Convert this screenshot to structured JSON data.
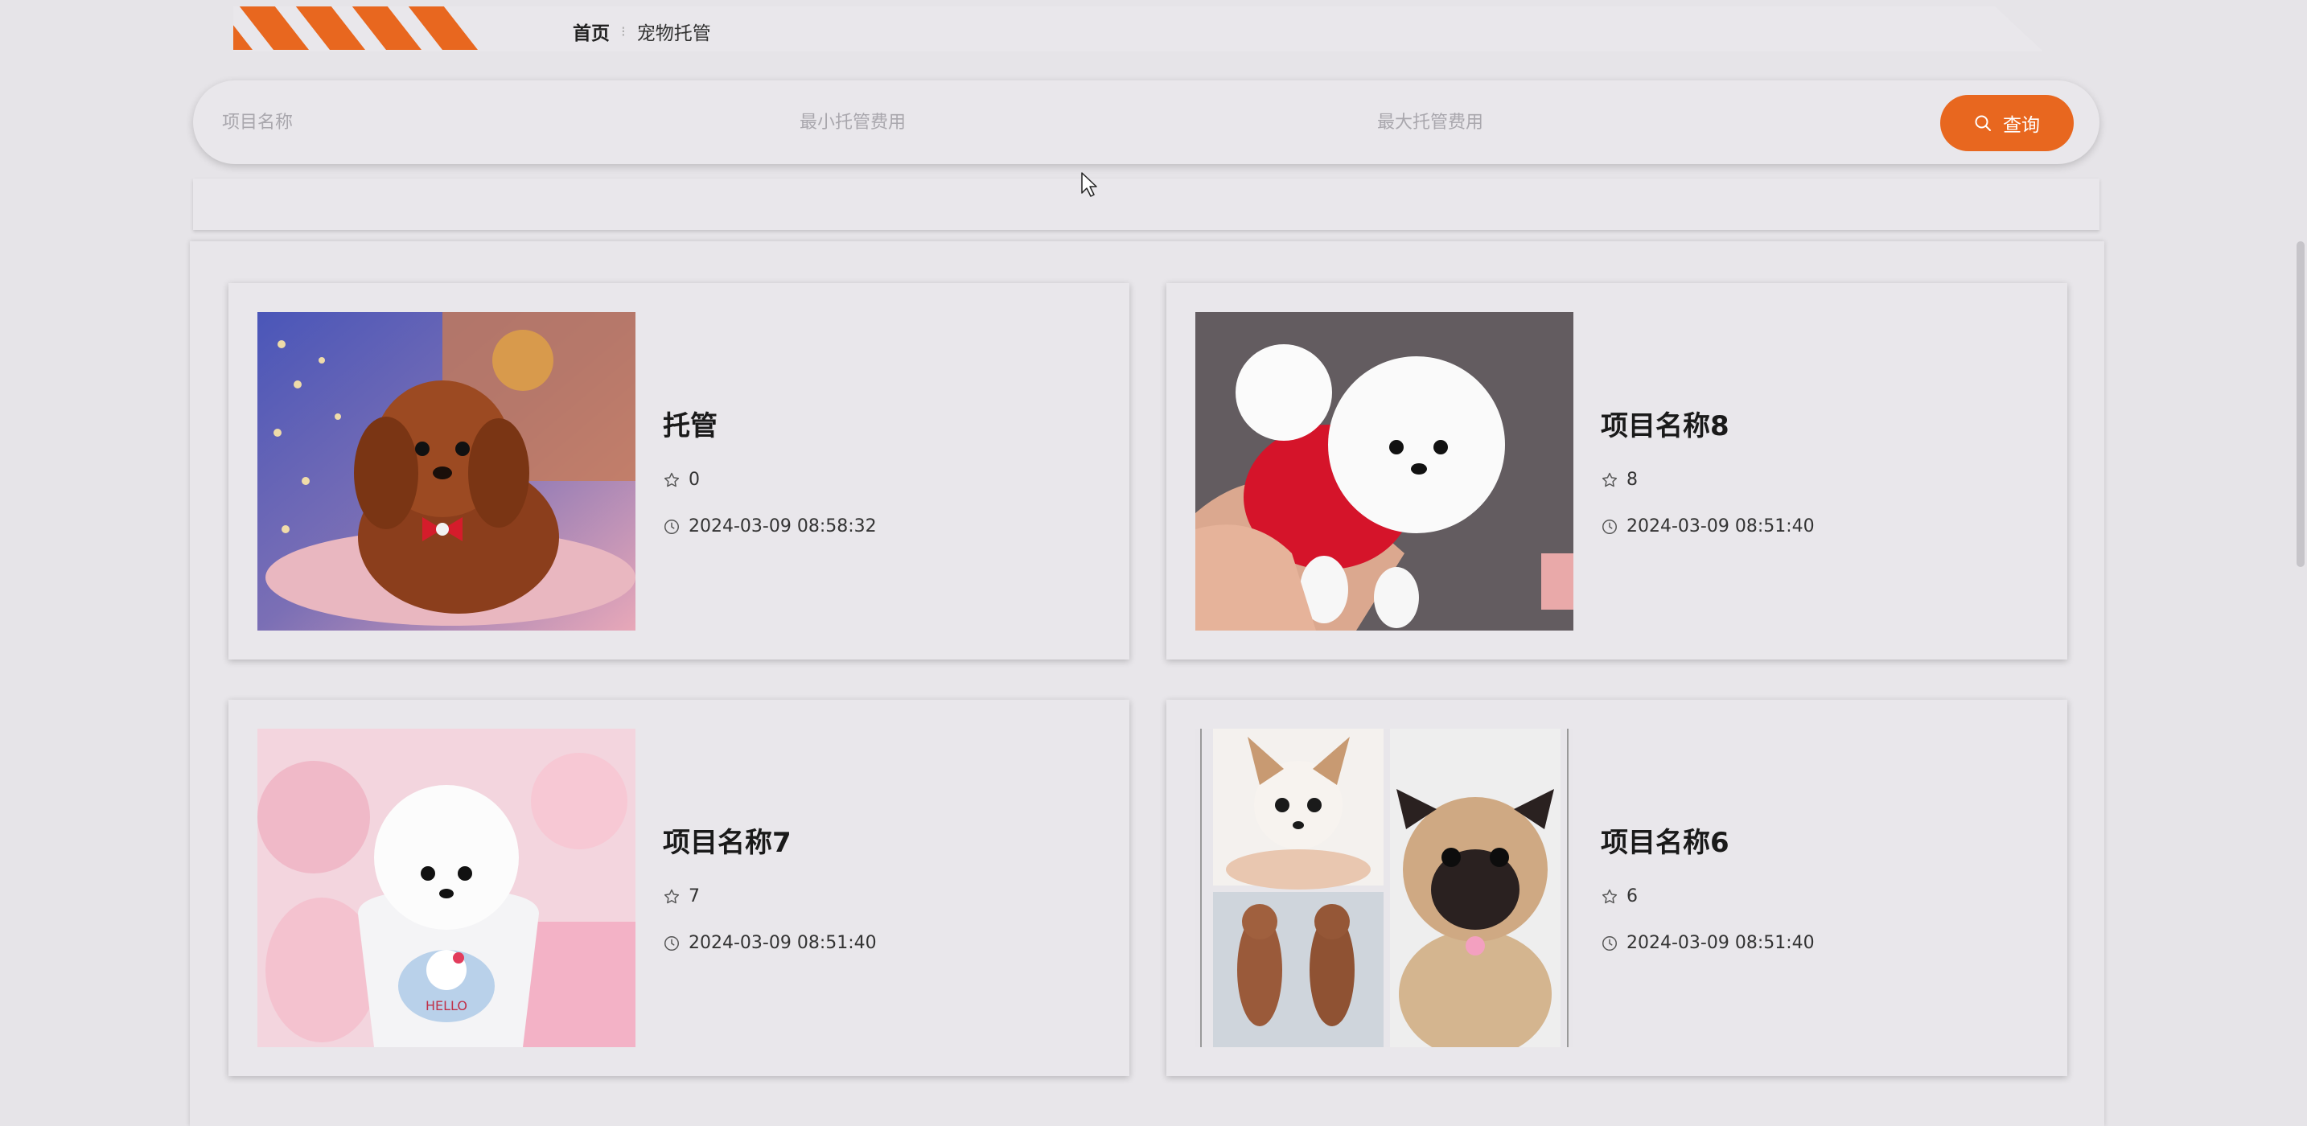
{
  "breadcrumb": {
    "home": "首页",
    "separator": "⁝",
    "current": "宠物托管"
  },
  "search": {
    "name_placeholder": "项目名称",
    "min_fee_placeholder": "最小托管费用",
    "max_fee_placeholder": "最大托管费用",
    "button_label": "查询",
    "button_icon": "search-icon"
  },
  "colors": {
    "accent": "#e8671f",
    "background": "#e6e4e8",
    "card": "#e9e7eb"
  },
  "items": [
    {
      "title": "托管",
      "views": "0",
      "time": "2024-03-09 08:58:32",
      "image": "brown toy poodle with red bow tie"
    },
    {
      "title": "项目名称8",
      "views": "8",
      "time": "2024-03-09 08:51:40",
      "image": "white pomeranian in red sweater held by hand"
    },
    {
      "title": "项目名称7",
      "views": "7",
      "time": "2024-03-09 08:51:40",
      "image": "white pomeranian puppy in Hello Kitty cup"
    },
    {
      "title": "项目名称6",
      "views": "6",
      "time": "2024-03-09 08:51:40",
      "image": "collage of chihuahua, pug and two brown puppies"
    }
  ]
}
